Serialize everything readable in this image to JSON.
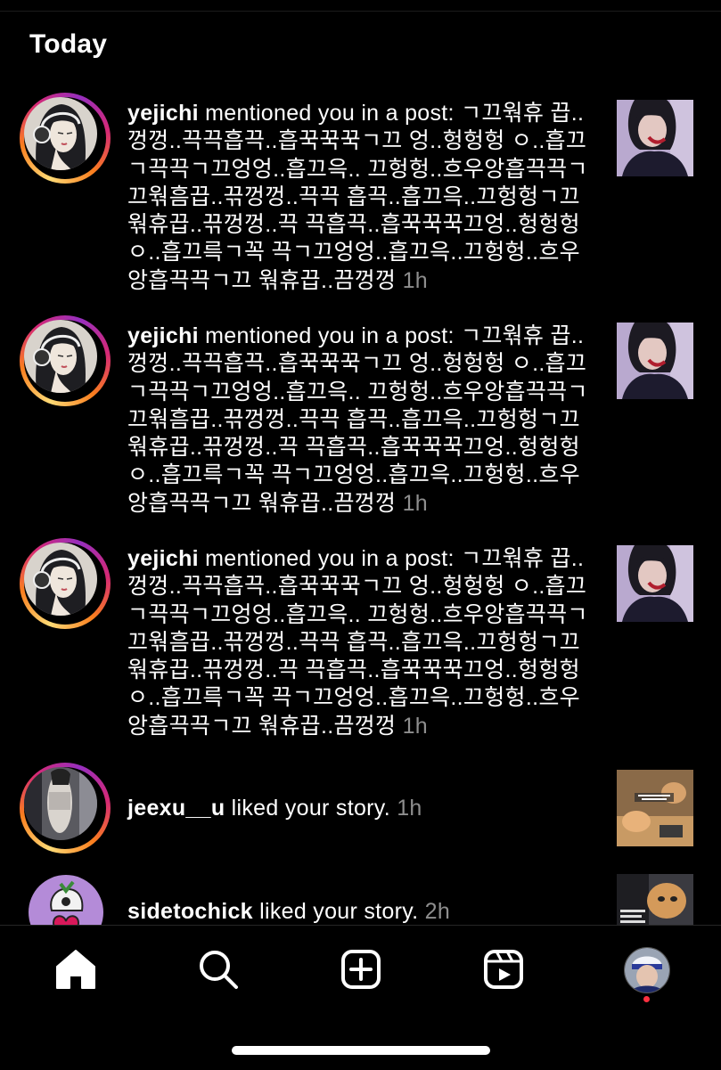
{
  "section": {
    "title": "Today"
  },
  "notifications": [
    {
      "user": "yejichi",
      "action": " mentioned you in a post: ㄱ끄웎휴 끕..껑껑..끅끅흡끅..흡꾹꾹꾹ㄱ끄 엉..헝헝헝 ㅇ..흡끄ㄱ끅끅ㄱ끄엉엉..흡끄윽.. 끄헝헝..흐우앙흡끅끅ㄱ끄웎흠끕..끆껑껑..끅끅 흡끅..흡끄윽..끄헝헝ㄱ끄웎휴끕..끆껑껑..끅 끅흡끅..흡꾹꾹꾹끄엉..헝헝헝 ㅇ..흡끄륵ㄱ꼭 끅ㄱ끄엉엉..흡끄윽..끄헝헝..흐우앙흡끅끅ㄱ끄 웎휴끕..끔껑껑",
      "time": " 1h"
    },
    {
      "user": "yejichi",
      "action": " mentioned you in a post: ㄱ끄웎휴 끕..껑껑..끅끅흡끅..흡꾹꾹꾹ㄱ끄 엉..헝헝헝 ㅇ..흡끄ㄱ끅끅ㄱ끄엉엉..흡끄윽.. 끄헝헝..흐우앙흡끅끅ㄱ끄웎흠끕..끆껑껑..끅끅 흡끅..흡끄윽..끄헝헝ㄱ끄웎휴끕..끆껑껑..끅 끅흡끅..흡꾹꾹꾹끄엉..헝헝헝 ㅇ..흡끄륵ㄱ꼭 끅ㄱ끄엉엉..흡끄윽..끄헝헝..흐우앙흡끅끅ㄱ끄 웎휴끕..끔껑껑",
      "time": " 1h"
    },
    {
      "user": "yejichi",
      "action": " mentioned you in a post: ㄱ끄웎휴 끕..껑껑..끅끅흡끅..흡꾹꾹꾹ㄱ끄 엉..헝헝헝 ㅇ..흡끄ㄱ끅끅ㄱ끄엉엉..흡끄윽.. 끄헝헝..흐우앙흡끅끅ㄱ끄웎흠끕..끆껑껑..끅끅 흡끅..흡끄윽..끄헝헝ㄱ끄웎휴끕..끆껑껑..끅 끅흡끅..흡꾹꾹꾹끄엉..헝헝헝 ㅇ..흡끄륵ㄱ꼭 끅ㄱ끄엉엉..흡끄윽..끄헝헝..흐우앙흡끅끅ㄱ끄 웎휴끕..끔껑껑",
      "time": " 1h"
    },
    {
      "user": "jeexu__u",
      "action": " liked your story.",
      "time": " 1h"
    },
    {
      "user": "sidetochick",
      "action": " liked your story.",
      "time": " 2h"
    }
  ],
  "nav": {
    "home": "home-icon",
    "search": "search-icon",
    "create": "add-post-icon",
    "reels": "reels-icon",
    "profile": "profile-avatar",
    "activity_dot_color": "#ff3040"
  },
  "colors": {
    "background": "#000000",
    "secondary_text": "#8e8e8e",
    "accent_dot": "#ff3040"
  }
}
